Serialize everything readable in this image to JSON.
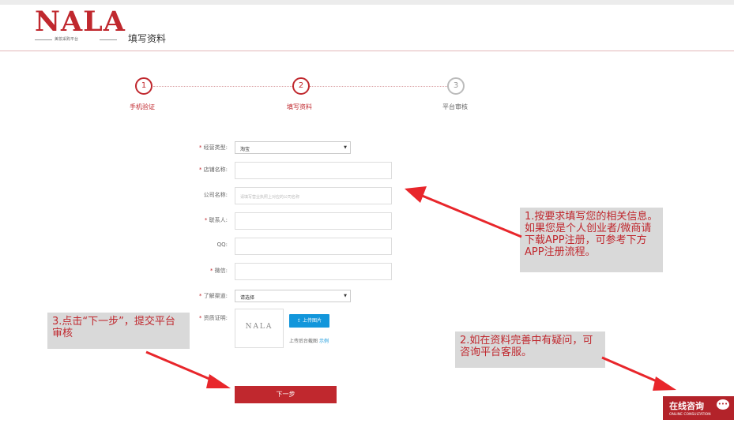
{
  "header": {
    "logo_text": "NALA",
    "logo_tagline": "美妆采购平台",
    "page_title": "填写资料"
  },
  "steps": [
    {
      "number": "1",
      "label": "手机验证",
      "state": "done"
    },
    {
      "number": "2",
      "label": "填写资料",
      "state": "active"
    },
    {
      "number": "3",
      "label": "平台审核",
      "state": "pending"
    }
  ],
  "form": {
    "business_type": {
      "label": "经营类型:",
      "required": true,
      "value": "淘宝"
    },
    "shop_name": {
      "label": "店铺名称:",
      "required": true,
      "value": ""
    },
    "company_name": {
      "label": "公司名称:",
      "required": false,
      "placeholder": "请填写营业执照上对应的公司名称"
    },
    "contact": {
      "label": "联系人:",
      "required": true,
      "value": ""
    },
    "qq": {
      "label": "QQ:",
      "required": false,
      "value": ""
    },
    "wechat": {
      "label": "微信:",
      "required": true,
      "value": ""
    },
    "channel": {
      "label": "了解渠道:",
      "required": true,
      "value": "请选择"
    },
    "credentials": {
      "label": "资质证明:",
      "required": true,
      "sample_logo": "NALA",
      "upload_label": "上传图片",
      "hint": "上传后台截图",
      "hint_link": "示例"
    },
    "next_label": "下一步"
  },
  "annotations": {
    "note1": "1.按要求填写您的相关信息。如果您是个人创业者/微商请下载APP注册，可参考下方APP注册流程。",
    "note2": "2.如在资料完善中有疑问，可咨询平台客服。",
    "note3": "3.点击“下一步”，提交平台审核"
  },
  "chat": {
    "label": "在线咨询",
    "sublabel": "ONLINE CONSULTATION",
    "icon": "chat-bubble-icon"
  },
  "colors": {
    "brand": "#c0282e",
    "annotation_text": "#c0282e",
    "annotation_bg": "#d9d9d9",
    "upload_button": "#1296db",
    "arrow": "#e8262b"
  }
}
